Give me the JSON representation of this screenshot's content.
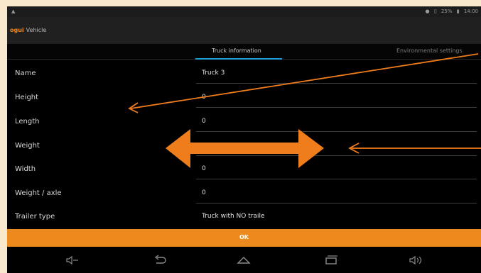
{
  "status_bar": {
    "left_icon": "notification-icon",
    "battery": "25%",
    "time": "14:00"
  },
  "app": {
    "logo": "ogui",
    "title": "Vehicle"
  },
  "tabs": [
    {
      "label": "Truck information"
    },
    {
      "label": "Environmental settings"
    }
  ],
  "fields": [
    {
      "label": "Name",
      "value": "Truck 3"
    },
    {
      "label": "Height",
      "value": "0"
    },
    {
      "label": "Length",
      "value": "0"
    },
    {
      "label": "Weight",
      "value": ""
    },
    {
      "label": "Width",
      "value": "0"
    },
    {
      "label": "Weight / axle",
      "value": "0"
    },
    {
      "label": "Trailer type",
      "value": "Truck with NO traile"
    }
  ],
  "ok_button": {
    "label": "OK"
  },
  "navigation_bar": [
    "volume-down-icon",
    "back-icon",
    "home-icon",
    "recent-apps-icon",
    "volume-up-icon"
  ],
  "annotation_color": "#f07d1c"
}
